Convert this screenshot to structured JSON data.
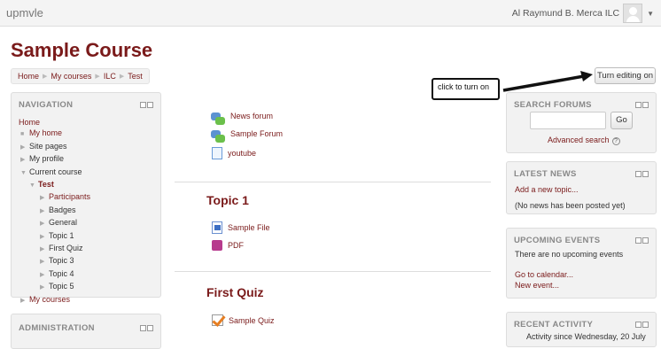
{
  "header": {
    "brand": "upmvle",
    "user_name": "Al Raymund B. Merca ILC"
  },
  "page": {
    "title": "Sample Course"
  },
  "breadcrumb": [
    "Home",
    "My courses",
    "ILC",
    "Test"
  ],
  "callout": {
    "text": "click to turn on"
  },
  "edit_button": "Turn editing on",
  "navigation": {
    "heading": "NAVIGATION",
    "home": "Home",
    "my_home": "My home",
    "site_pages": "Site pages",
    "my_profile": "My profile",
    "current_course": "Current course",
    "test": "Test",
    "participants": "Participants",
    "badges": "Badges",
    "general": "General",
    "topic1": "Topic 1",
    "first_quiz": "First Quiz",
    "topic3": "Topic 3",
    "topic4": "Topic 4",
    "topic5": "Topic 5",
    "my_courses": "My courses"
  },
  "administration": {
    "heading": "ADMINISTRATION"
  },
  "main": {
    "news_forum": "News forum",
    "sample_forum": "Sample Forum",
    "youtube": "youtube",
    "topic1_title": "Topic 1",
    "sample_file": "Sample File",
    "pdf": "PDF",
    "first_quiz_title": "First Quiz",
    "sample_quiz": "Sample Quiz"
  },
  "search_forums": {
    "heading": "SEARCH FORUMS",
    "go": "Go",
    "advanced": "Advanced search"
  },
  "latest_news": {
    "heading": "LATEST NEWS",
    "add": "Add a new topic...",
    "none": "(No news has been posted yet)"
  },
  "upcoming_events": {
    "heading": "UPCOMING EVENTS",
    "none": "There are no upcoming events",
    "calendar": "Go to calendar...",
    "new_event": "New event..."
  },
  "recent_activity": {
    "heading": "RECENT ACTIVITY",
    "since": "Activity since Wednesday, 20 July"
  }
}
